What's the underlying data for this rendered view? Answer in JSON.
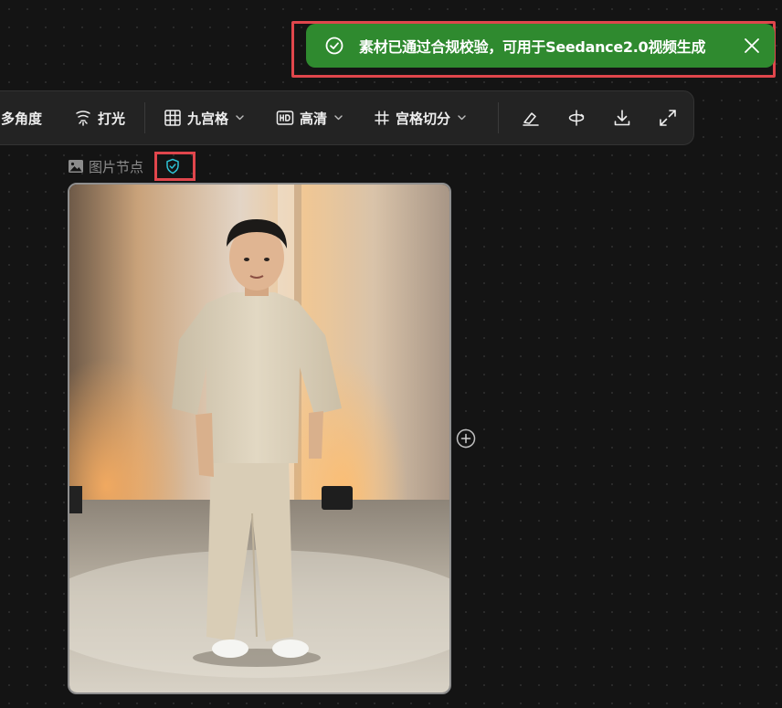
{
  "toast": {
    "message": "素材已通过合规校验，可用于Seedance2.0视频生成",
    "status_icon": "check-circle-icon",
    "close_icon": "close-icon",
    "background_color": "#2f8a2f",
    "highlight_color": "#e0464c"
  },
  "toolbar": {
    "items": [
      {
        "label": "多角度"
      },
      {
        "label": "打光",
        "icon": "lighting-icon"
      },
      {
        "label": "九宫格",
        "icon": "grid-icon"
      },
      {
        "label": "高清",
        "icon": "hd-icon"
      },
      {
        "label": "宫格切分",
        "icon": "hash-icon"
      }
    ],
    "actions": [
      "eraser-icon",
      "flip-icon",
      "download-icon",
      "expand-icon"
    ]
  },
  "node": {
    "label": "图片节点",
    "label_icon": "image-icon",
    "shield_icon": "shield-check-icon",
    "shield_color": "#2ec4d6",
    "add_icon": "plus-circle-icon"
  }
}
